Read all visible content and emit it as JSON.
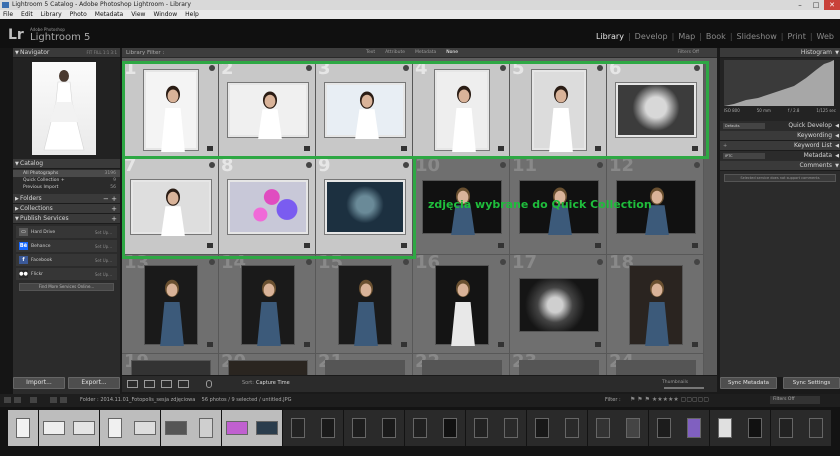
{
  "window": {
    "title": "Lightroom 5 Catalog - Adobe Photoshop Lightroom - Library"
  },
  "menu": [
    "File",
    "Edit",
    "Library",
    "Photo",
    "Metadata",
    "View",
    "Window",
    "Help"
  ],
  "brand": {
    "logo": "Lr",
    "vendor": "Adobe Photoshop",
    "product": "Lightroom 5"
  },
  "modules": [
    {
      "label": "Library",
      "active": true
    },
    {
      "label": "Develop",
      "active": false
    },
    {
      "label": "Map",
      "active": false
    },
    {
      "label": "Book",
      "active": false
    },
    {
      "label": "Slideshow",
      "active": false
    },
    {
      "label": "Print",
      "active": false
    },
    {
      "label": "Web",
      "active": false
    }
  ],
  "left_panel": {
    "navigator": {
      "title": "Navigator",
      "options": "FIT FILL 1:1 3:1"
    },
    "catalog": {
      "title": "Catalog",
      "items": [
        {
          "label": "All Photographs",
          "count": "3196",
          "selected": true
        },
        {
          "label": "Quick Collection +",
          "count": "9",
          "selected": false
        },
        {
          "label": "Previous Import",
          "count": "56",
          "selected": false
        }
      ]
    },
    "folders": {
      "title": "Folders"
    },
    "collections": {
      "title": "Collections"
    },
    "publish": {
      "title": "Publish Services",
      "services": [
        {
          "label": "Hard Drive",
          "setup": "Set Up...",
          "icon": "hard-drive-icon",
          "color": "#5a5a5a",
          "glyph": "▭"
        },
        {
          "label": "Behance",
          "setup": "Set Up...",
          "icon": "behance-icon",
          "color": "#1769ff",
          "glyph": "Bē"
        },
        {
          "label": "Facebook",
          "setup": "Set Up...",
          "icon": "facebook-icon",
          "color": "#3b5998",
          "glyph": "f"
        },
        {
          "label": "Flickr",
          "setup": "Set Up...",
          "icon": "flickr-icon",
          "color": "#2a2a2a",
          "glyph": "●●"
        }
      ],
      "find_more": "Find More Services Online..."
    },
    "import_label": "Import...",
    "export_label": "Export..."
  },
  "library_filter": {
    "label": "Library Filter :",
    "options": [
      {
        "label": "Text",
        "on": false
      },
      {
        "label": "Attribute",
        "on": false
      },
      {
        "label": "Metadata",
        "on": false
      },
      {
        "label": "None",
        "on": true
      }
    ],
    "filters_off": "Filters Off"
  },
  "grid": {
    "cells": [
      {
        "n": "1",
        "selected": true
      },
      {
        "n": "2",
        "selected": true
      },
      {
        "n": "3",
        "selected": true
      },
      {
        "n": "4",
        "selected": true
      },
      {
        "n": "5",
        "selected": true
      },
      {
        "n": "6",
        "selected": true
      },
      {
        "n": "7",
        "selected": true
      },
      {
        "n": "8",
        "selected": true
      },
      {
        "n": "9",
        "selected": true
      },
      {
        "n": "10",
        "selected": false
      },
      {
        "n": "11",
        "selected": false
      },
      {
        "n": "12",
        "selected": false
      },
      {
        "n": "13",
        "selected": false
      },
      {
        "n": "14",
        "selected": false
      },
      {
        "n": "15",
        "selected": false
      },
      {
        "n": "16",
        "selected": false
      },
      {
        "n": "17",
        "selected": false
      },
      {
        "n": "18",
        "selected": false
      },
      {
        "n": "19",
        "selected": false
      },
      {
        "n": "20",
        "selected": false
      },
      {
        "n": "21",
        "selected": false
      },
      {
        "n": "22",
        "selected": false
      },
      {
        "n": "23",
        "selected": false
      },
      {
        "n": "24",
        "selected": false
      }
    ],
    "annotation": "zdjęcia wybrane do Quick Collection",
    "annotation_color": "#1fbe3c"
  },
  "toolbar": {
    "sort_label": "Sort:",
    "sort_value": "Capture Time",
    "thumbnails_label": "Thumbnails"
  },
  "right_panel": {
    "histogram": {
      "title": "Histogram",
      "iso": "ISO 800",
      "shutter": "1/125 sec",
      "aperture": "f / 2.8",
      "focal": "50 mm"
    },
    "quick_develop": {
      "title": "Quick Develop",
      "preset": "Defaults"
    },
    "keywording": {
      "title": "Keywording"
    },
    "keyword_list": {
      "title": "Keyword List"
    },
    "metadata": {
      "title": "Metadata",
      "preset": "IPTC"
    },
    "comments": {
      "title": "Comments",
      "note": "Selected service does not support comments"
    },
    "sync_metadata": "Sync Metadata",
    "sync_settings": "Sync Settings"
  },
  "filmstrip_bar": {
    "source": "Folder : 2014.11.01_Fotopolis_sesja zdjęciowa",
    "count": "56 photos / 9 selected / untitled.JPG",
    "filter_label": "Filter :",
    "filters_off": "Filters Off"
  },
  "colors": {
    "selection_green": "#2ea844",
    "accent_active": "#e8e8e8"
  }
}
